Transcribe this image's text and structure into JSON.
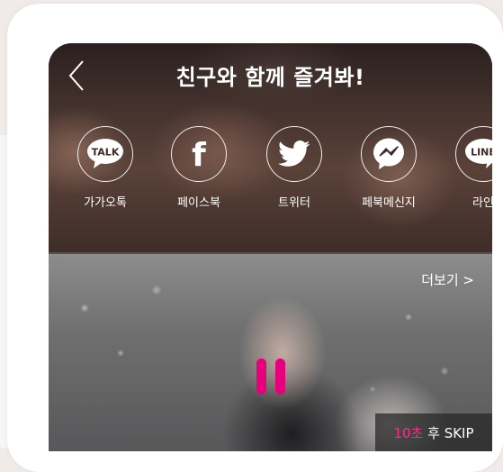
{
  "header": {
    "title": "친구와 함께 즐겨봐!",
    "back_icon": "chevron-left-icon"
  },
  "share": {
    "items": [
      {
        "label": "가가오톡",
        "icon": "kakaotalk-icon",
        "icon_text": "TALK"
      },
      {
        "label": "페이스북",
        "icon": "facebook-icon",
        "icon_text": "f"
      },
      {
        "label": "트위터",
        "icon": "twitter-icon"
      },
      {
        "label": "페북메신지",
        "icon": "messenger-icon"
      },
      {
        "label": "라인",
        "icon": "line-icon",
        "icon_text": "LINE"
      }
    ]
  },
  "video": {
    "more_label": "더보기 >",
    "pause_icon": "pause-icon",
    "skip": {
      "count": "10초",
      "text": " 후 SKIP"
    },
    "accent_color": "#e6007e"
  }
}
